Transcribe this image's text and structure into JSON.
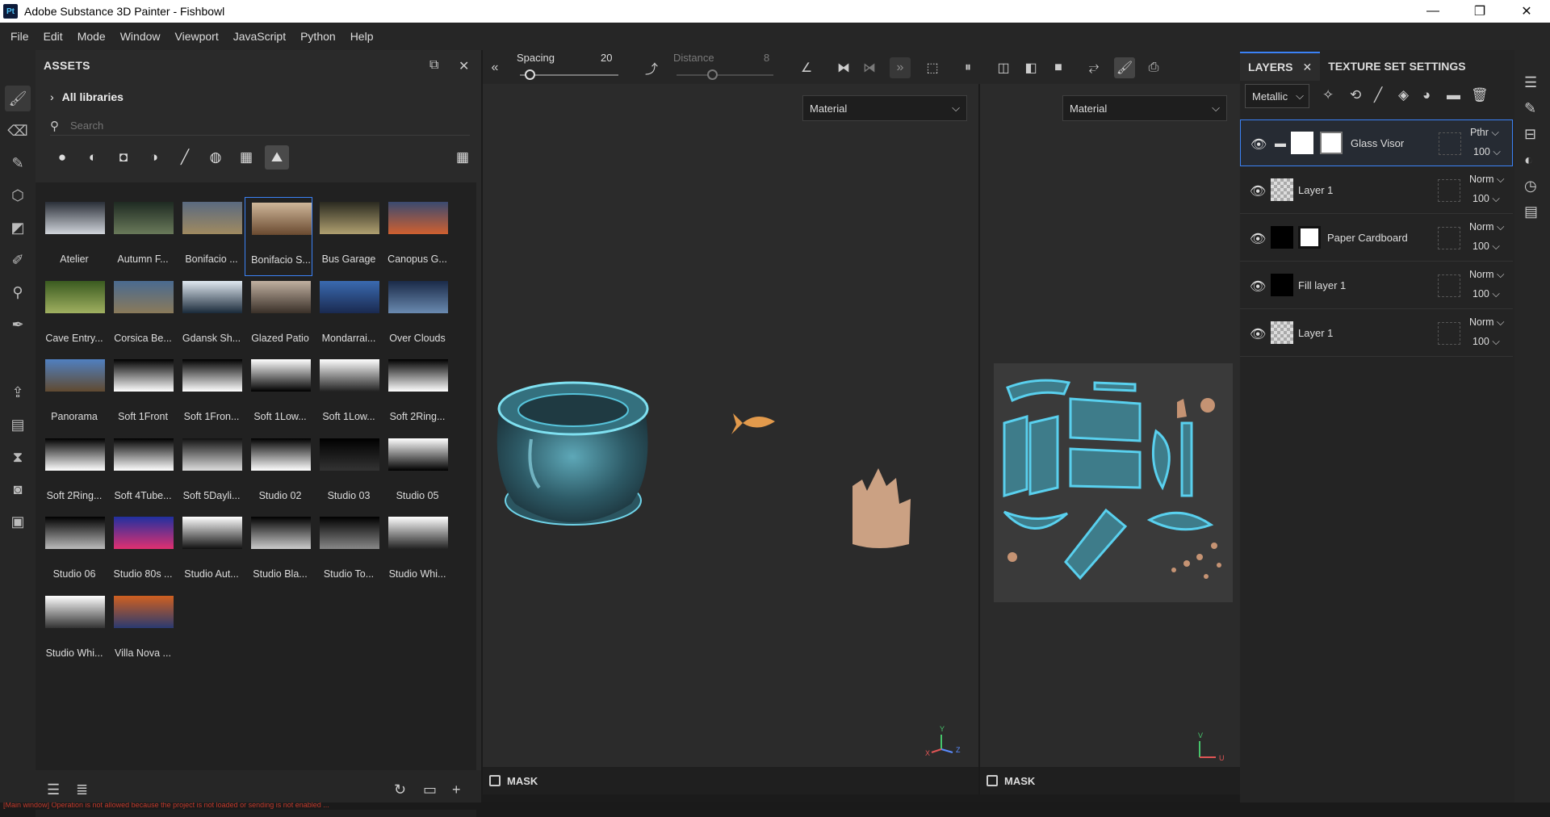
{
  "window": {
    "title": "Adobe Substance 3D Painter - Fishbowl",
    "app_icon": "Pt",
    "controls": [
      "—",
      "❐",
      "✕"
    ]
  },
  "menu": [
    "File",
    "Edit",
    "Mode",
    "Window",
    "Viewport",
    "JavaScript",
    "Python",
    "Help"
  ],
  "assets": {
    "title": "ASSETS",
    "library": "All libraries",
    "search_placeholder": "Search",
    "items": [
      {
        "label": "Atelier",
        "colors": [
          "#2a2f38",
          "#d0d4da"
        ]
      },
      {
        "label": "Autumn F...",
        "colors": [
          "#1e2a22",
          "#6a7a5a"
        ]
      },
      {
        "label": "Bonifacio ...",
        "colors": [
          "#5a6a80",
          "#a08a60"
        ]
      },
      {
        "label": "Bonifacio S...",
        "colors": [
          "#cfb79a",
          "#6a4a30"
        ],
        "selected": true
      },
      {
        "label": "Bus Garage",
        "colors": [
          "#2a2a20",
          "#b0a070"
        ]
      },
      {
        "label": "Canopus G...",
        "colors": [
          "#3a4a70",
          "#d06030"
        ]
      },
      {
        "label": "Cave Entry...",
        "colors": [
          "#3a5a20",
          "#a0b060"
        ]
      },
      {
        "label": "Corsica Be...",
        "colors": [
          "#4a6a90",
          "#8a7a5a"
        ]
      },
      {
        "label": "Gdansk Sh...",
        "colors": [
          "#e0e8f0",
          "#1a2a3a"
        ]
      },
      {
        "label": "Glazed Patio",
        "colors": [
          "#c0b0a0",
          "#3a3028"
        ]
      },
      {
        "label": "Mondarrai...",
        "colors": [
          "#3a6ab0",
          "#1a2a50"
        ]
      },
      {
        "label": "Over Clouds",
        "colors": [
          "#1a2a48",
          "#6a8ab0"
        ]
      },
      {
        "label": "Panorama",
        "colors": [
          "#5080c0",
          "#604a30"
        ]
      },
      {
        "label": "Soft 1Front",
        "colors": [
          "#000000",
          "#ffffff"
        ]
      },
      {
        "label": "Soft 1Fron...",
        "colors": [
          "#000000",
          "#ffffff"
        ]
      },
      {
        "label": "Soft 1Low...",
        "colors": [
          "#ffffff",
          "#000000"
        ]
      },
      {
        "label": "Soft 1Low...",
        "colors": [
          "#ffffff",
          "#222222"
        ]
      },
      {
        "label": "Soft 2Ring...",
        "colors": [
          "#000000",
          "#ffffff"
        ]
      },
      {
        "label": "Soft 2Ring...",
        "colors": [
          "#000000",
          "#ffffff"
        ]
      },
      {
        "label": "Soft 4Tube...",
        "colors": [
          "#000000",
          "#ffffff"
        ]
      },
      {
        "label": "Soft 5Dayli...",
        "colors": [
          "#111111",
          "#dddddd"
        ]
      },
      {
        "label": "Studio 02",
        "colors": [
          "#000000",
          "#ffffff"
        ]
      },
      {
        "label": "Studio 03",
        "colors": [
          "#000000",
          "#333333"
        ]
      },
      {
        "label": "Studio 05",
        "colors": [
          "#ffffff",
          "#000000"
        ]
      },
      {
        "label": "Studio 06",
        "colors": [
          "#000000",
          "#bbbbbb"
        ]
      },
      {
        "label": "Studio 80s ...",
        "colors": [
          "#2030a0",
          "#e03070"
        ]
      },
      {
        "label": "Studio Aut...",
        "colors": [
          "#ffffff",
          "#111111"
        ]
      },
      {
        "label": "Studio Bla...",
        "colors": [
          "#000000",
          "#cccccc"
        ]
      },
      {
        "label": "Studio To...",
        "colors": [
          "#000000",
          "#888888"
        ]
      },
      {
        "label": "Studio Whi...",
        "colors": [
          "#ffffff",
          "#222222"
        ]
      },
      {
        "label": "Studio Whi...",
        "colors": [
          "#ffffff",
          "#333333"
        ]
      },
      {
        "label": "Villa Nova ...",
        "colors": [
          "#d06020",
          "#2a3a70"
        ]
      }
    ]
  },
  "toolbar": {
    "spacing_label": "Spacing",
    "spacing_value": "20",
    "distance_label": "Distance",
    "distance_value": "8"
  },
  "viewports": {
    "left_channel": "Material",
    "right_channel": "Material",
    "mask_label": "MASK",
    "axis_y": "Y",
    "axis_x": "X",
    "axis_z": "Z",
    "axis_v": "V",
    "axis_u": "U"
  },
  "layers": {
    "tab_layers": "LAYERS",
    "tab_texture": "TEXTURE SET SETTINGS",
    "channel": "Metallic",
    "rows": [
      {
        "name": "Glass Visor",
        "blend": "Pthr",
        "opacity": "100",
        "type": "folder"
      },
      {
        "name": "Layer 1",
        "blend": "Norm",
        "opacity": "100",
        "type": "paint"
      },
      {
        "name": "Paper Cardboard",
        "blend": "Norm",
        "opacity": "100",
        "type": "fill-mask"
      },
      {
        "name": "Fill layer 1",
        "blend": "Norm",
        "opacity": "100",
        "type": "fill"
      },
      {
        "name": "Layer 1",
        "blend": "Norm",
        "opacity": "100",
        "type": "paint"
      }
    ]
  },
  "status": "[Main window] Operation is not allowed because the project is not loaded or sending is not enabled ..."
}
